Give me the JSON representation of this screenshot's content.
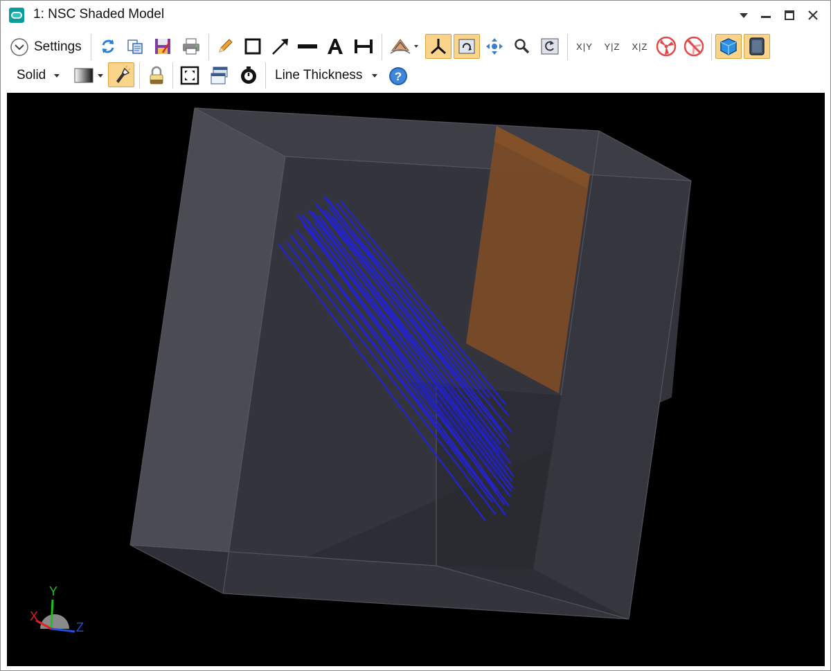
{
  "window": {
    "title": "1: NSC Shaded Model",
    "controls": [
      "dropdown-arrow",
      "minimize",
      "maximize",
      "close"
    ]
  },
  "toolbar1": {
    "settings_label": "Settings",
    "buttons": [
      "refresh-icon",
      "copy-icon",
      "save-icon",
      "print-icon",
      "pencil-icon",
      "rectangle-icon",
      "arrow-icon",
      "line-icon",
      "text-icon",
      "dimension-icon",
      "rotate-view-icon",
      "axes-icon",
      "redraw-icon",
      "pan-icon",
      "zoom-icon",
      "reset-view-icon",
      "xy-view-icon",
      "yz-view-icon",
      "xz-view-icon",
      "fan-icon",
      "no-fan-icon",
      "solid-cube-icon",
      "device-icon"
    ],
    "view_labels": {
      "xy": "X|Y",
      "yz": "Y|Z",
      "xz": "X|Z"
    }
  },
  "toolbar2": {
    "render_mode": "Solid",
    "line_thickness_label": "Line Thickness",
    "buttons": [
      "gradient-icon",
      "flashlight-icon",
      "lock-icon",
      "fit-view-icon",
      "window-icon",
      "timer-icon",
      "help-icon"
    ]
  },
  "axes_triad": {
    "x": "X",
    "y": "Y",
    "z": "Z"
  },
  "colors": {
    "rays": "#2323c8",
    "box_face": "#3a3a44",
    "detector": "#7a4c28",
    "viewport_bg": "#000000",
    "toolbar_active": "#fbd48c",
    "axis_x": "#e02020",
    "axis_y": "#20c020",
    "axis_z": "#2050e0"
  }
}
